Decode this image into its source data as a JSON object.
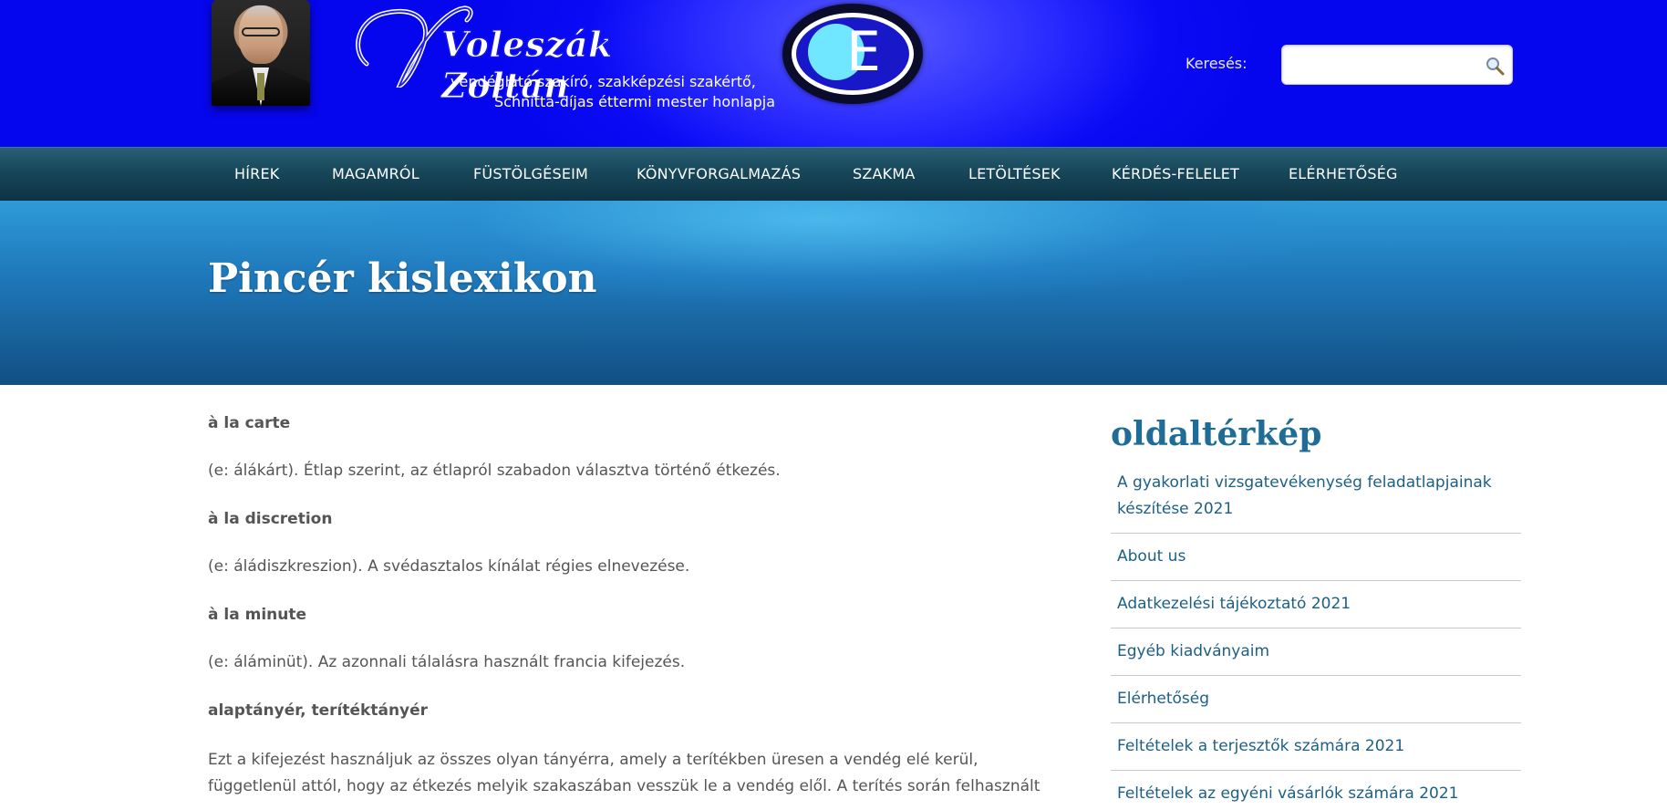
{
  "header": {
    "logo_name": "Voleszák Zoltán",
    "logo_subtitle_1": "vendéglátó szakíró, szakképzési szakértő,",
    "logo_subtitle_2": "Schnitta-díjas éttermi mester honlapja",
    "search_label": "Keresés:",
    "search_value": "",
    "search_placeholder": ""
  },
  "nav": {
    "items": [
      {
        "label": "HÍREK"
      },
      {
        "label": "MAGAMRÓL"
      },
      {
        "label": "FÜSTÖLGÉSEIM"
      },
      {
        "label": "KÖNYVFORGALMAZÁS"
      },
      {
        "label": "SZAKMA"
      },
      {
        "label": "LETÖLTÉSEK"
      },
      {
        "label": "KÉRDÉS-FELELET"
      },
      {
        "label": "ELÉRHETŐSÉG"
      }
    ]
  },
  "page": {
    "title": "Pincér kislexikon"
  },
  "entries": [
    {
      "term": "à la carte",
      "definition": "(e: álákárt). Étlap szerint, az étlapról szabadon választva történő étkezés."
    },
    {
      "term": "à la discretion",
      "definition": "(e: áládiszkreszion). A svédasztalos kínálat régies elnevezése."
    },
    {
      "term": "à la minute",
      "definition": "(e: áláminüt). Az azonnali tálalásra használt francia kifejezés."
    },
    {
      "term": "alaptányér, terítéktányér",
      "definition": "Ezt a kifejezést használjuk az összes olyan tányérra, amely a terítékben üresen a vendég elé kerül, függetlenül attól, hogy az étkezés melyik szakaszában vesszük le a vendég elől. A terítés során felhasznált"
    }
  ],
  "sidebar": {
    "title": "oldaltérkép",
    "items": [
      {
        "label": "A gyakorlati vizsgatevékenység feladatlapjainak készítése 2021"
      },
      {
        "label": "About us"
      },
      {
        "label": "Adatkezelési tájékoztató 2021"
      },
      {
        "label": "Egyéb kiadványaim"
      },
      {
        "label": "Elérhetőség"
      },
      {
        "label": "Feltételek a terjesztők számára 2021"
      },
      {
        "label": "Feltételek az egyéni vásárlók számára 2021"
      }
    ]
  },
  "colors": {
    "header_blue": "#0a0af5",
    "nav_teal": "#17475a",
    "banner_blue": "#1f79bb",
    "link_blue": "#1c5f86",
    "sidebar_title": "#1f6d97"
  }
}
